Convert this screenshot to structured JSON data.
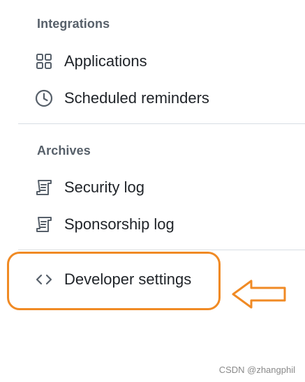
{
  "integrations": {
    "heading": "Integrations",
    "items": [
      {
        "label": "Applications",
        "icon": "apps-grid-icon"
      },
      {
        "label": "Scheduled reminders",
        "icon": "clock-icon"
      }
    ]
  },
  "archives": {
    "heading": "Archives",
    "items": [
      {
        "label": "Security log",
        "icon": "log-icon"
      },
      {
        "label": "Sponsorship log",
        "icon": "log-icon"
      }
    ]
  },
  "developer": {
    "label": "Developer settings",
    "icon": "code-icon"
  },
  "annotation": {
    "highlight_color": "#f08a24",
    "arrow_color": "#f08a24"
  },
  "watermark": "CSDN @zhangphil"
}
